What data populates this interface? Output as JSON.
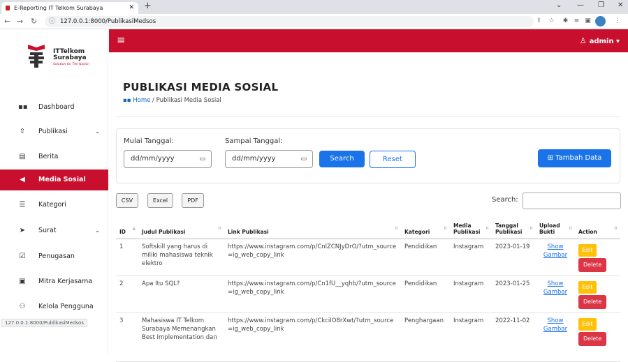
{
  "browser": {
    "tab_title": "E-Reporting IT Telkom Surabaya",
    "url": "127.0.0.1:8000/PublikasiMedsos",
    "status_url": "127.0.0.1:8000/PublikasiMedsos"
  },
  "sidebar": {
    "brand": "ITTelkom",
    "brand_sub": "Surabaya",
    "tagline": "Solution for The Nation",
    "items": [
      {
        "label": "Dashboard",
        "icon": "dashboard-icon"
      },
      {
        "label": "Publikasi",
        "icon": "upload-icon"
      },
      {
        "label": "Berita",
        "icon": "newspaper-icon"
      },
      {
        "label": "Media Sosial",
        "icon": "megaphone-icon"
      },
      {
        "label": "Kategori",
        "icon": "list-icon"
      },
      {
        "label": "Surat",
        "icon": "send-icon"
      },
      {
        "label": "Penugasan",
        "icon": "clipboard-icon"
      },
      {
        "label": "Mitra Kerjasama",
        "icon": "id-card-icon"
      },
      {
        "label": "Kelola Pengguna",
        "icon": "users-icon"
      }
    ]
  },
  "header": {
    "user": "admin"
  },
  "main": {
    "title": "PUBLIKASI MEDIA SOSIAL",
    "breadcrumb_home": "Home",
    "breadcrumb_current": "/ Publikasi Media Sosial"
  },
  "filter": {
    "start_label": "Mulai Tanggal:",
    "end_label": "Sampai Tanggal:",
    "date_placeholder": "dd/mm/yyyy",
    "search_btn": "Search",
    "reset_btn": "Reset",
    "add_btn": "Tambah Data"
  },
  "table_tools": {
    "csv": "CSV",
    "excel": "Excel",
    "pdf": "PDF",
    "search_label": "Search:"
  },
  "table": {
    "headers": [
      "ID",
      "Judul Publikasi",
      "Link Publikasi",
      "Kategori",
      "Media Publikasi",
      "Tanggal Publikasi",
      "Upload Bukti",
      "Action"
    ],
    "show_label": "Show Gambar",
    "edit_label": "Edit",
    "delete_label": "Delete",
    "rows": [
      {
        "id": "1",
        "judul": "Softskill yang harus di miliki mahasiswa teknik elektro",
        "link": "https://www.instagram.com/p/CnlZCNJyDrO/?utm_source=ig_web_copy_link",
        "kategori": "Pendidikan",
        "media": "Instagram",
        "tanggal": "2023-01-19"
      },
      {
        "id": "2",
        "judul": "Apa Itu SQL?",
        "link": "https://www.instagram.com/p/Cn1fU__yqhb/?utm_source=ig_web_copy_link",
        "kategori": "Pendidikan",
        "media": "Instagram",
        "tanggal": "2023-01-25"
      },
      {
        "id": "3",
        "judul": "Mahasiswa IT Telkom Surabaya Memenangkan Best Implementation dan",
        "link": "https://www.instagram.com/p/CkciIO8rXwt/?utm_source=ig_web_copy_link",
        "kategori": "Penghargaan",
        "media": "Instagram",
        "tanggal": "2022-11-02"
      }
    ]
  }
}
